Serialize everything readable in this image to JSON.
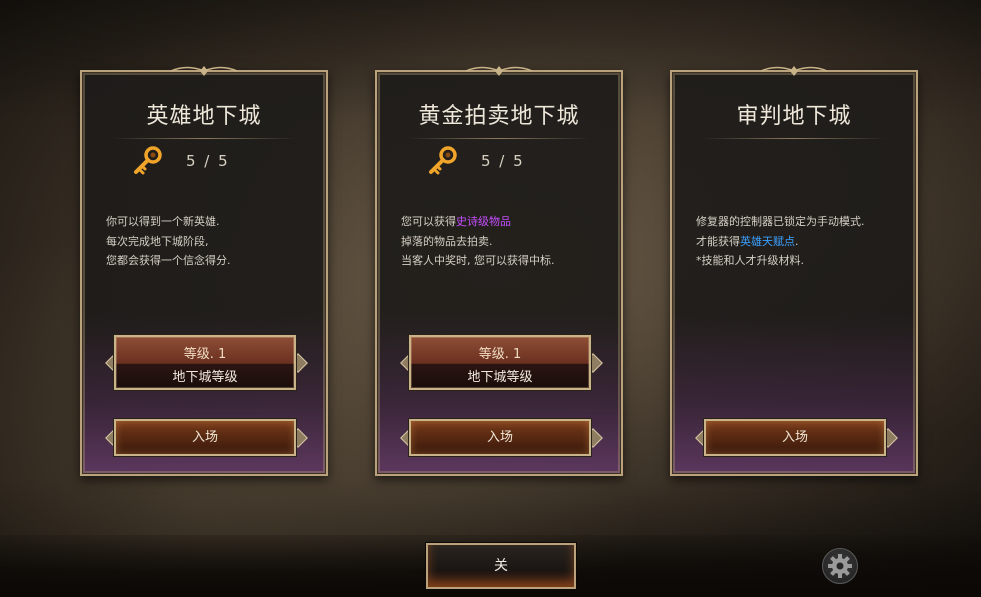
{
  "cards": [
    {
      "title": "英雄地下城",
      "key_count": "5 / 5",
      "desc_lines": [
        {
          "pre": "你可以得到一个新英雄.",
          "hl": "",
          "post": ""
        },
        {
          "pre": "每次完成地下城阶段,",
          "hl": "",
          "post": ""
        },
        {
          "pre": "您都会获得一个信念得分.",
          "hl": "",
          "post": ""
        }
      ],
      "level_label": "等级. 1",
      "level_caption": "地下城等级",
      "enter_label": "入场"
    },
    {
      "title": "黄金拍卖地下城",
      "key_count": "5 / 5",
      "desc_lines": [
        {
          "pre": "您可以获得",
          "hl": "史诗级物品",
          "post": ""
        },
        {
          "pre": "掉落的物品去拍卖.",
          "hl": "",
          "post": ""
        },
        {
          "pre": "当客人中奖时, 您可以获得中标.",
          "hl": "",
          "post": ""
        }
      ],
      "level_label": "等级. 1",
      "level_caption": "地下城等级",
      "enter_label": "入场"
    },
    {
      "title": "审判地下城",
      "desc_lines": [
        {
          "pre": "修复器的控制器已锁定为手动模式.",
          "hl": "",
          "post": ""
        },
        {
          "pre": "才能获得",
          "hl": "英雄天赋点",
          "post": "."
        },
        {
          "pre": "*技能和人才升级材料.",
          "hl": "",
          "post": ""
        }
      ],
      "enter_label": "入场"
    }
  ],
  "colors": {
    "highlight_purple": "#c64dff",
    "highlight_blue": "#3aa0ff",
    "frame_gold": "#b9a27c"
  },
  "icons": {
    "key": "key-icon",
    "settings": "gear-icon"
  },
  "footer": {
    "close_label": "关"
  }
}
